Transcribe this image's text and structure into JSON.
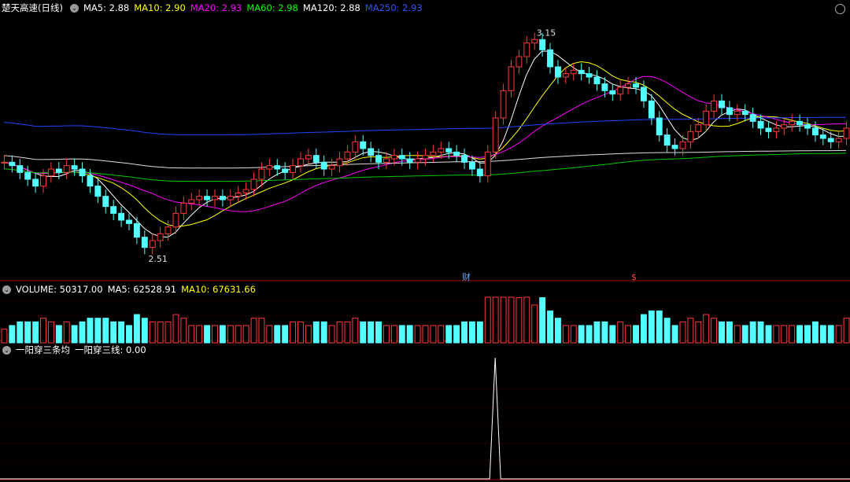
{
  "title": "楚天高速(日线)",
  "ma_legend": [
    {
      "label": "MA5: 2.88",
      "color": "#ffffff"
    },
    {
      "label": "MA10: 2.90",
      "color": "#ffff00"
    },
    {
      "label": "MA20: 2.93",
      "color": "#ff00ff"
    },
    {
      "label": "MA60: 2.98",
      "color": "#00ff00"
    },
    {
      "label": "MA120: 2.88",
      "color": "#ffffff"
    },
    {
      "label": "MA250: 2.93",
      "color": "#3355ff"
    }
  ],
  "volume_legend": [
    {
      "label": "VOLUME: 50317.00",
      "color": "#ffffff"
    },
    {
      "label": "MA5: 62528.91",
      "color": "#ffffff"
    },
    {
      "label": "MA10: 67631.66",
      "color": "#ffff00"
    }
  ],
  "indicator_legend": [
    {
      "label": "一阳穿三条均",
      "color": "#ffffff"
    },
    {
      "label": "一阳穿三线: 0.00",
      "color": "#ffffff"
    }
  ],
  "annotations": {
    "high_label": "3.15",
    "low_label": "2.51",
    "marker_cai": "财",
    "marker_dollar": "$"
  },
  "chart_data": {
    "type": "candlestick",
    "price_range": [
      2.45,
      3.2
    ],
    "high": 3.15,
    "low": 2.51,
    "closes": [
      2.77,
      2.76,
      2.74,
      2.72,
      2.7,
      2.73,
      2.75,
      2.74,
      2.76,
      2.75,
      2.73,
      2.7,
      2.67,
      2.64,
      2.62,
      2.6,
      2.59,
      2.55,
      2.52,
      2.54,
      2.56,
      2.58,
      2.62,
      2.65,
      2.66,
      2.67,
      2.66,
      2.67,
      2.66,
      2.67,
      2.68,
      2.69,
      2.72,
      2.75,
      2.76,
      2.75,
      2.74,
      2.76,
      2.78,
      2.79,
      2.77,
      2.75,
      2.76,
      2.78,
      2.8,
      2.83,
      2.81,
      2.79,
      2.77,
      2.78,
      2.79,
      2.78,
      2.77,
      2.78,
      2.79,
      2.8,
      2.81,
      2.8,
      2.79,
      2.77,
      2.75,
      2.73,
      2.8,
      2.9,
      2.98,
      3.05,
      3.08,
      3.12,
      3.13,
      3.1,
      3.05,
      3.02,
      3.03,
      3.04,
      3.03,
      3.02,
      3.0,
      2.98,
      2.97,
      2.99,
      3.0,
      2.99,
      2.95,
      2.9,
      2.85,
      2.82,
      2.81,
      2.83,
      2.86,
      2.88,
      2.92,
      2.95,
      2.93,
      2.91,
      2.92,
      2.91,
      2.89,
      2.87,
      2.86,
      2.87,
      2.88,
      2.89,
      2.88,
      2.87,
      2.85,
      2.84,
      2.83,
      2.84,
      2.87
    ],
    "volume_max": 200000,
    "indicator_signal_index": 63,
    "indicator_signal_value": 1
  }
}
